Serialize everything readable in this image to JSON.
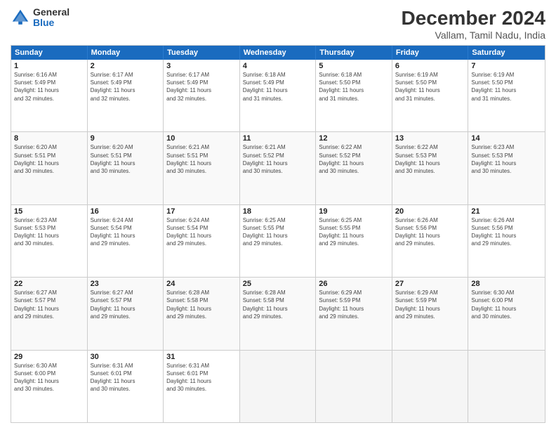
{
  "logo": {
    "general": "General",
    "blue": "Blue"
  },
  "title": "December 2024",
  "subtitle": "Vallam, Tamil Nadu, India",
  "weekdays": [
    "Sunday",
    "Monday",
    "Tuesday",
    "Wednesday",
    "Thursday",
    "Friday",
    "Saturday"
  ],
  "rows": [
    [
      {
        "day": "1",
        "info": "Sunrise: 6:16 AM\nSunset: 5:49 PM\nDaylight: 11 hours\nand 32 minutes."
      },
      {
        "day": "2",
        "info": "Sunrise: 6:17 AM\nSunset: 5:49 PM\nDaylight: 11 hours\nand 32 minutes."
      },
      {
        "day": "3",
        "info": "Sunrise: 6:17 AM\nSunset: 5:49 PM\nDaylight: 11 hours\nand 32 minutes."
      },
      {
        "day": "4",
        "info": "Sunrise: 6:18 AM\nSunset: 5:49 PM\nDaylight: 11 hours\nand 31 minutes."
      },
      {
        "day": "5",
        "info": "Sunrise: 6:18 AM\nSunset: 5:50 PM\nDaylight: 11 hours\nand 31 minutes."
      },
      {
        "day": "6",
        "info": "Sunrise: 6:19 AM\nSunset: 5:50 PM\nDaylight: 11 hours\nand 31 minutes."
      },
      {
        "day": "7",
        "info": "Sunrise: 6:19 AM\nSunset: 5:50 PM\nDaylight: 11 hours\nand 31 minutes."
      }
    ],
    [
      {
        "day": "8",
        "info": "Sunrise: 6:20 AM\nSunset: 5:51 PM\nDaylight: 11 hours\nand 30 minutes."
      },
      {
        "day": "9",
        "info": "Sunrise: 6:20 AM\nSunset: 5:51 PM\nDaylight: 11 hours\nand 30 minutes."
      },
      {
        "day": "10",
        "info": "Sunrise: 6:21 AM\nSunset: 5:51 PM\nDaylight: 11 hours\nand 30 minutes."
      },
      {
        "day": "11",
        "info": "Sunrise: 6:21 AM\nSunset: 5:52 PM\nDaylight: 11 hours\nand 30 minutes."
      },
      {
        "day": "12",
        "info": "Sunrise: 6:22 AM\nSunset: 5:52 PM\nDaylight: 11 hours\nand 30 minutes."
      },
      {
        "day": "13",
        "info": "Sunrise: 6:22 AM\nSunset: 5:53 PM\nDaylight: 11 hours\nand 30 minutes."
      },
      {
        "day": "14",
        "info": "Sunrise: 6:23 AM\nSunset: 5:53 PM\nDaylight: 11 hours\nand 30 minutes."
      }
    ],
    [
      {
        "day": "15",
        "info": "Sunrise: 6:23 AM\nSunset: 5:53 PM\nDaylight: 11 hours\nand 30 minutes."
      },
      {
        "day": "16",
        "info": "Sunrise: 6:24 AM\nSunset: 5:54 PM\nDaylight: 11 hours\nand 29 minutes."
      },
      {
        "day": "17",
        "info": "Sunrise: 6:24 AM\nSunset: 5:54 PM\nDaylight: 11 hours\nand 29 minutes."
      },
      {
        "day": "18",
        "info": "Sunrise: 6:25 AM\nSunset: 5:55 PM\nDaylight: 11 hours\nand 29 minutes."
      },
      {
        "day": "19",
        "info": "Sunrise: 6:25 AM\nSunset: 5:55 PM\nDaylight: 11 hours\nand 29 minutes."
      },
      {
        "day": "20",
        "info": "Sunrise: 6:26 AM\nSunset: 5:56 PM\nDaylight: 11 hours\nand 29 minutes."
      },
      {
        "day": "21",
        "info": "Sunrise: 6:26 AM\nSunset: 5:56 PM\nDaylight: 11 hours\nand 29 minutes."
      }
    ],
    [
      {
        "day": "22",
        "info": "Sunrise: 6:27 AM\nSunset: 5:57 PM\nDaylight: 11 hours\nand 29 minutes."
      },
      {
        "day": "23",
        "info": "Sunrise: 6:27 AM\nSunset: 5:57 PM\nDaylight: 11 hours\nand 29 minutes."
      },
      {
        "day": "24",
        "info": "Sunrise: 6:28 AM\nSunset: 5:58 PM\nDaylight: 11 hours\nand 29 minutes."
      },
      {
        "day": "25",
        "info": "Sunrise: 6:28 AM\nSunset: 5:58 PM\nDaylight: 11 hours\nand 29 minutes."
      },
      {
        "day": "26",
        "info": "Sunrise: 6:29 AM\nSunset: 5:59 PM\nDaylight: 11 hours\nand 29 minutes."
      },
      {
        "day": "27",
        "info": "Sunrise: 6:29 AM\nSunset: 5:59 PM\nDaylight: 11 hours\nand 29 minutes."
      },
      {
        "day": "28",
        "info": "Sunrise: 6:30 AM\nSunset: 6:00 PM\nDaylight: 11 hours\nand 30 minutes."
      }
    ],
    [
      {
        "day": "29",
        "info": "Sunrise: 6:30 AM\nSunset: 6:00 PM\nDaylight: 11 hours\nand 30 minutes."
      },
      {
        "day": "30",
        "info": "Sunrise: 6:31 AM\nSunset: 6:01 PM\nDaylight: 11 hours\nand 30 minutes."
      },
      {
        "day": "31",
        "info": "Sunrise: 6:31 AM\nSunset: 6:01 PM\nDaylight: 11 hours\nand 30 minutes."
      },
      {
        "day": "",
        "info": ""
      },
      {
        "day": "",
        "info": ""
      },
      {
        "day": "",
        "info": ""
      },
      {
        "day": "",
        "info": ""
      }
    ]
  ]
}
